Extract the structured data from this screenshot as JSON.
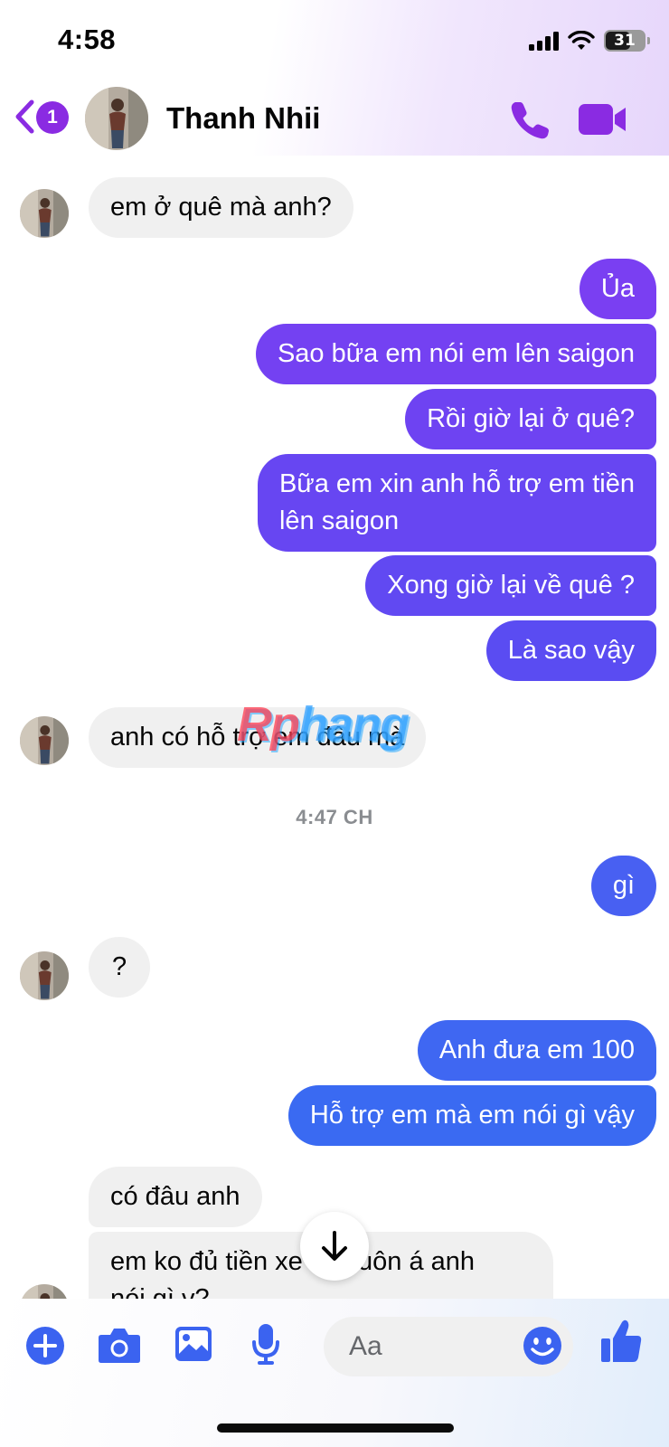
{
  "status_bar": {
    "time": "4:58",
    "battery": "31"
  },
  "header": {
    "back_badge": "1",
    "contact_name": "Thanh Nhii"
  },
  "messages": [
    {
      "from": "them",
      "text": "em ở quê mà anh?"
    },
    {
      "from": "me",
      "text": "Ủa"
    },
    {
      "from": "me",
      "text": "Sao bữa em nói em lên saigon"
    },
    {
      "from": "me",
      "text": "Rồi giờ lại ở quê?"
    },
    {
      "from": "me",
      "lines": [
        "Bữa em xin anh hỗ trợ em tiền",
        "lên saigon"
      ]
    },
    {
      "from": "me",
      "text": "Xong giờ lại về quê ?"
    },
    {
      "from": "me",
      "text": "Là sao vậy"
    },
    {
      "from": "them",
      "text": "anh có hỗ trợ em đâu mà"
    },
    {
      "from": "me",
      "text": "gì"
    },
    {
      "from": "them",
      "text": "?"
    },
    {
      "from": "me",
      "text": "Anh đưa em 100"
    },
    {
      "from": "me",
      "text": "Hỗ trợ em mà em nói gì vậy"
    },
    {
      "from": "them",
      "text": "có đâu anh"
    },
    {
      "from": "them",
      "lines": [
        "em ko đủ tiền xe lên luôn á anh",
        "nói gì v?"
      ]
    }
  ],
  "timestamp": "4:47 CH",
  "watermark": {
    "part1": "Rp",
    "part2": "hang"
  },
  "composer": {
    "placeholder": "Aa"
  },
  "colors": {
    "accent_purple": "#8a2be2",
    "bubble_top": "#7a3ff2",
    "bubble_bottom": "#3d6ff3",
    "incoming_bubble": "#f0f0f0",
    "composer_icon": "#3b63f0"
  }
}
